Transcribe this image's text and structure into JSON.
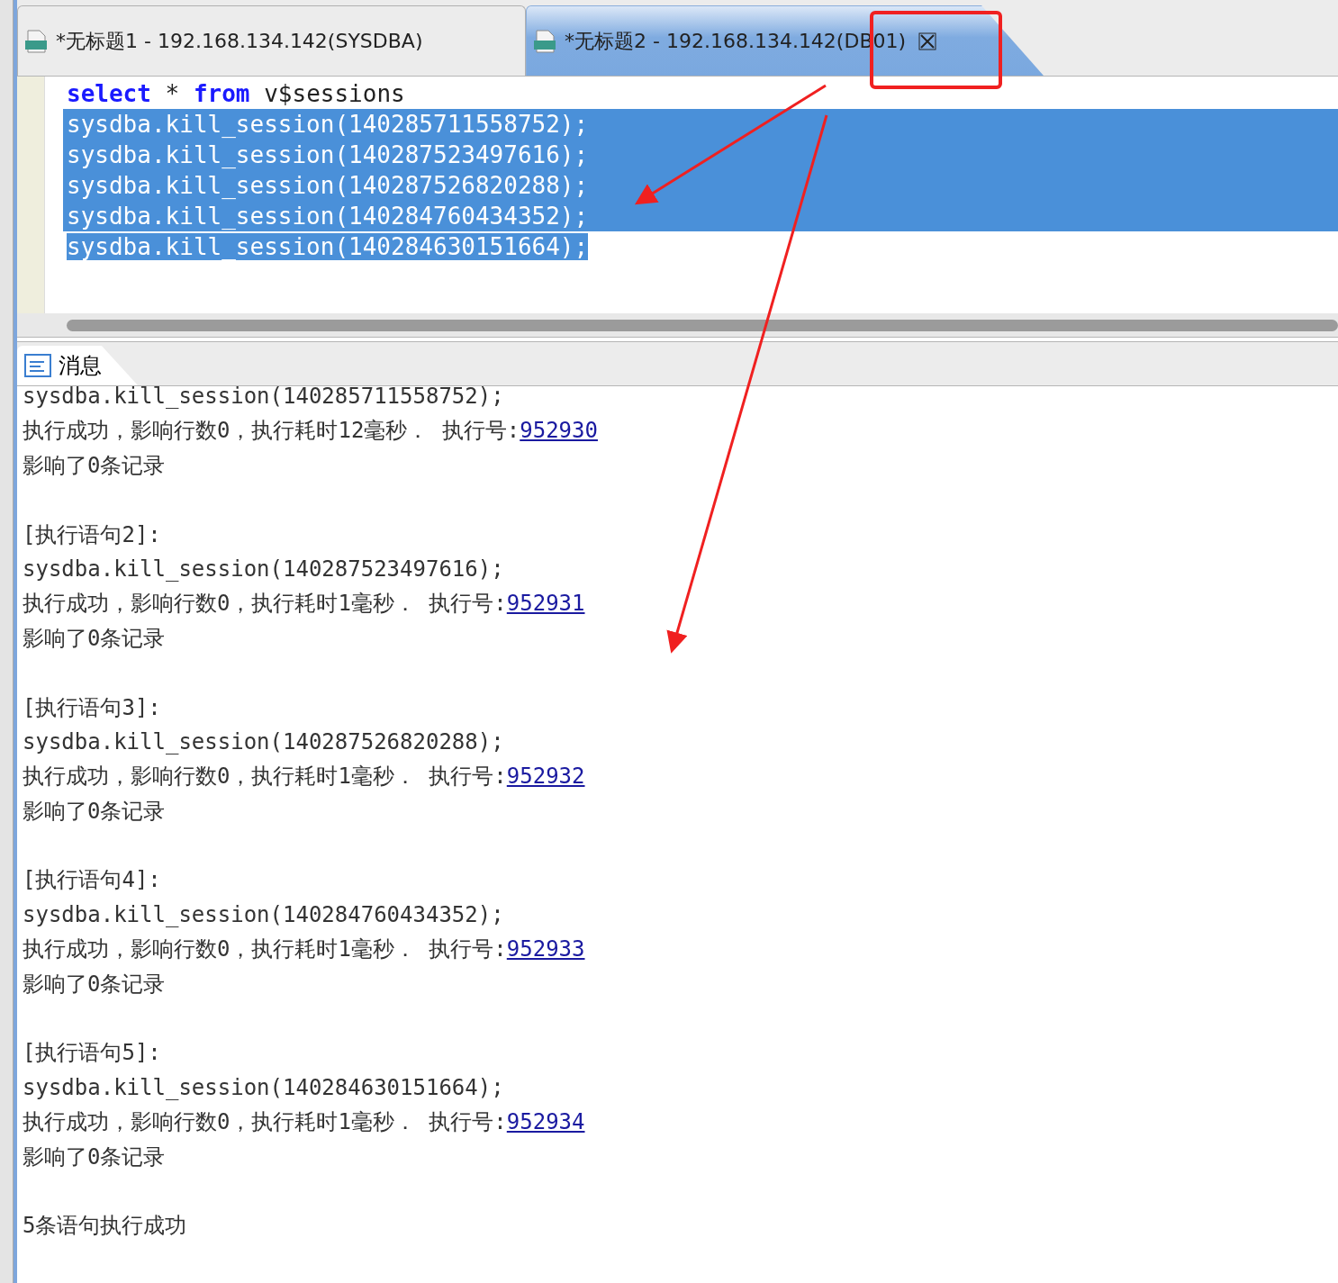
{
  "tabs": [
    {
      "title": "*无标题1 - 192.168.134.142(SYSDBA)",
      "selected": false,
      "closable": false
    },
    {
      "title": "*无标题2 - 192.168.134.142(DB01)",
      "selected": true,
      "closable": true
    }
  ],
  "editor": {
    "lines": [
      {
        "selected": false,
        "tokens": [
          {
            "text": "select",
            "kind": "keyword"
          },
          {
            "text": " * ",
            "kind": "plain"
          },
          {
            "text": "from",
            "kind": "keyword"
          },
          {
            "text": " v$sessions",
            "kind": "plain"
          }
        ]
      },
      {
        "selected": true,
        "tokens": [
          {
            "text": "sysdba.kill_session(140285711558752);",
            "kind": "plain"
          }
        ]
      },
      {
        "selected": true,
        "tokens": [
          {
            "text": "sysdba.kill_session(140287523497616);",
            "kind": "plain"
          }
        ]
      },
      {
        "selected": true,
        "tokens": [
          {
            "text": "sysdba.kill_session(140287526820288);",
            "kind": "plain"
          }
        ]
      },
      {
        "selected": true,
        "tokens": [
          {
            "text": "sysdba.kill_session(140284760434352);",
            "kind": "plain"
          }
        ]
      },
      {
        "selected": true,
        "tokens": [
          {
            "text": "sysdba.kill_session(140284630151664);",
            "kind": "plain"
          }
        ]
      }
    ]
  },
  "messages_tab": {
    "title": "消息",
    "selected": true
  },
  "messages": [
    {
      "sql": "sysdba.kill_session(140285711558752);",
      "result": "执行成功，影响行数0，执行耗时12毫秒． 执行号:",
      "exec_no": "952930",
      "affected": "影响了0条记录"
    },
    {
      "label": "[执行语句2]:",
      "sql": "sysdba.kill_session(140287523497616);",
      "result": "执行成功，影响行数0，执行耗时1毫秒． 执行号:",
      "exec_no": "952931",
      "affected": "影响了0条记录"
    },
    {
      "label": "[执行语句3]:",
      "sql": "sysdba.kill_session(140287526820288);",
      "result": "执行成功，影响行数0，执行耗时1毫秒． 执行号:",
      "exec_no": "952932",
      "affected": "影响了0条记录"
    },
    {
      "label": "[执行语句4]:",
      "sql": "sysdba.kill_session(140284760434352);",
      "result": "执行成功，影响行数0，执行耗时1毫秒． 执行号:",
      "exec_no": "952933",
      "affected": "影响了0条记录"
    },
    {
      "label": "[执行语句5]:",
      "sql": "sysdba.kill_session(140284630151664);",
      "result": "执行成功，影响行数0，执行耗时1毫秒． 执行号:",
      "exec_no": "952934",
      "affected": "影响了0条记录"
    }
  ],
  "summary": "5条语句执行成功"
}
